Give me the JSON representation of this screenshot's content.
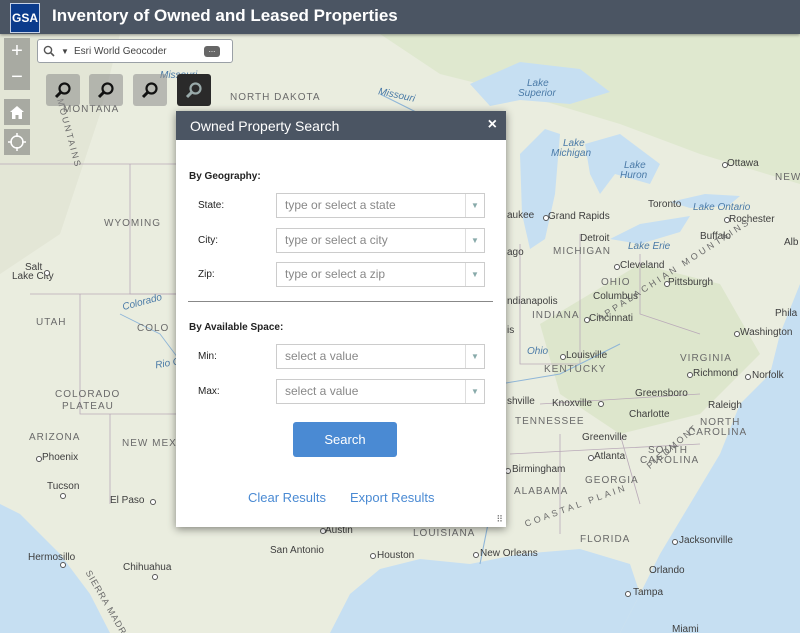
{
  "header": {
    "logo_text": "GSA",
    "title": "Inventory of Owned and Leased Properties"
  },
  "map": {
    "geocoder": {
      "source": "Esri World Geocoder",
      "more_label": "..."
    },
    "zoom_in_label": "+",
    "zoom_out_label": "−",
    "tools": [
      {
        "icon": "search-icon"
      },
      {
        "icon": "search-icon"
      },
      {
        "icon": "search-icon"
      },
      {
        "icon": "search-icon"
      }
    ],
    "labels": {
      "north_dakota": "NORTH DAKOTA",
      "montana": "MONTANA",
      "missouri_top": "Missouri",
      "missouri_river": "Missouri",
      "lake_superior_1": "Lake",
      "lake_superior_2": "Superior",
      "lake_michigan_1": "Lake",
      "lake_michigan_2": "Michigan",
      "lake_huron_1": "Lake",
      "lake_huron_2": "Huron",
      "lake_ontario": "Lake Ontario",
      "lake_erie": "Lake Erie",
      "ottawa": "Ottawa",
      "new": "NEW",
      "toronto": "Toronto",
      "rochester": "Rochester",
      "buffalo": "Buffalo",
      "alb": "Alb",
      "waukee": "aukee",
      "grand_rapids": "Grand Rapids",
      "detroit": "Detroit",
      "michigan": "MICHIGAN",
      "cleveland": "Cleveland",
      "ohio": "OHIO",
      "columbus": "Columbus",
      "pittsburgh": "Pittsburgh",
      "indianapolis": "ndianapolis",
      "indiana": "INDIANA",
      "cincinnati": "Cincinnati",
      "ago": "ago",
      "philadelphia": "Phila",
      "washington": "Washington",
      "appalachian": "APPALACHIAN MOUNTAINS",
      "wyoming": "WYOMING",
      "salt_lake_1": "Salt",
      "salt_lake_2": "Lake City",
      "utah": "UTAH",
      "colorado": "COLORADO",
      "colorado_river": "Colorado",
      "colo": "COLO",
      "rio_grande": "Rio Grande",
      "colorado_plateau_1": "COLORADO",
      "colorado_plateau_2": "PLATEAU",
      "arizona": "ARIZONA",
      "new_mex": "NEW MEX",
      "phoenix": "Phoenix",
      "tucson": "Tucson",
      "el_paso": "El Paso",
      "hermosillo": "Hermosillo",
      "chihuahua": "Chihuahua",
      "sierra": "SIERRA MADRE",
      "rocky": "MOUNTAINS",
      "austin": "Austin",
      "san_antonio": "San Antonio",
      "houston": "Houston",
      "louisiana": "LOUISIANA",
      "new_orleans": "New Orleans",
      "louisville": "Louisville",
      "kentucky": "KENTUCKY",
      "nashville": "shville",
      "knoxville": "Knoxville",
      "tennessee": "TENNESSEE",
      "ohio_river": "Ohio",
      "is": "is",
      "virginia": "VIRGINIA",
      "richmond": "Richmond",
      "norfolk": "Norfolk",
      "greensboro": "Greensboro",
      "charlotte": "Charlotte",
      "raleigh": "Raleigh",
      "north_carolina_1": "NORTH",
      "north_carolina_2": "CAROLINA",
      "piedmont": "PIEDMONT",
      "greenville": "Greenville",
      "atlanta": "Atlanta",
      "south_carolina_1": "SOUTH",
      "south_carolina_2": "CAROLINA",
      "birmingham": "Birmingham",
      "georgia": "GEORGIA",
      "alabama": "ALABAMA",
      "coastal_plain": "COASTAL PLAIN",
      "florida": "FLORIDA",
      "jacksonville": "Jacksonville",
      "orlando": "Orlando",
      "tampa": "Tampa",
      "miami": "Miami"
    }
  },
  "panel": {
    "title": "Owned Property Search",
    "close_label": "×",
    "geography": {
      "title": "By Geography:",
      "state_label": "State:",
      "state_placeholder": "type or select a state",
      "city_label": "City:",
      "city_placeholder": "type or select a city",
      "zip_label": "Zip:",
      "zip_placeholder": "type or select a zip"
    },
    "space": {
      "title": "By Available Space:",
      "min_label": "Min:",
      "min_placeholder": "select a value",
      "max_label": "Max:",
      "max_placeholder": "select a value"
    },
    "search_label": "Search",
    "clear_label": "Clear Results",
    "export_label": "Export Results",
    "resize_glyph": "⠿"
  },
  "colors": {
    "header_bg": "#4b5563",
    "accent": "#4a8ad3",
    "water": "#c6dff2",
    "land": "#e9ecdf"
  }
}
